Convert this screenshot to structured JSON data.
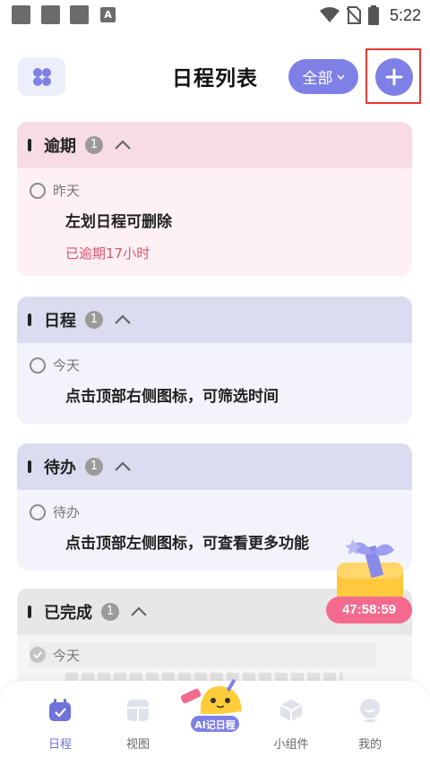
{
  "status_bar": {
    "time": "5:22",
    "notification_icon_letter": "A"
  },
  "header": {
    "title": "日程列表",
    "filter_label": "全部",
    "menu_icon": "grid-icon",
    "add_icon": "plus-icon"
  },
  "sections": {
    "overdue": {
      "title": "逾期",
      "count": "1",
      "item": {
        "date": "昨天",
        "title": "左划日程可删除",
        "status": "已逾期17小时"
      }
    },
    "schedule": {
      "title": "日程",
      "count": "1",
      "item": {
        "date": "今天",
        "title": "点击顶部右侧图标，可筛选时间"
      }
    },
    "todo": {
      "title": "待办",
      "count": "1",
      "item": {
        "date": "待办",
        "title": "点击顶部左侧图标，可查看更多功能"
      }
    },
    "done": {
      "title": "已完成",
      "count": "1",
      "item": {
        "date": "今天"
      }
    }
  },
  "promo": {
    "countdown": "47:58:59"
  },
  "bottom_nav": {
    "items": [
      {
        "label": "日程",
        "icon": "calendar-icon",
        "active": true
      },
      {
        "label": "视图",
        "icon": "view-grid-icon",
        "active": false
      },
      {
        "label": "小组件",
        "icon": "cube-icon",
        "active": false
      },
      {
        "label": "我的",
        "icon": "profile-icon",
        "active": false
      }
    ],
    "ai_label": "AI记日程"
  },
  "colors": {
    "accent": "#7e80e6",
    "overdue_header": "#f7dce3",
    "schedule_header": "#dcdcf0",
    "overdue_text": "#e0506b",
    "timer": "#f36a8e"
  }
}
